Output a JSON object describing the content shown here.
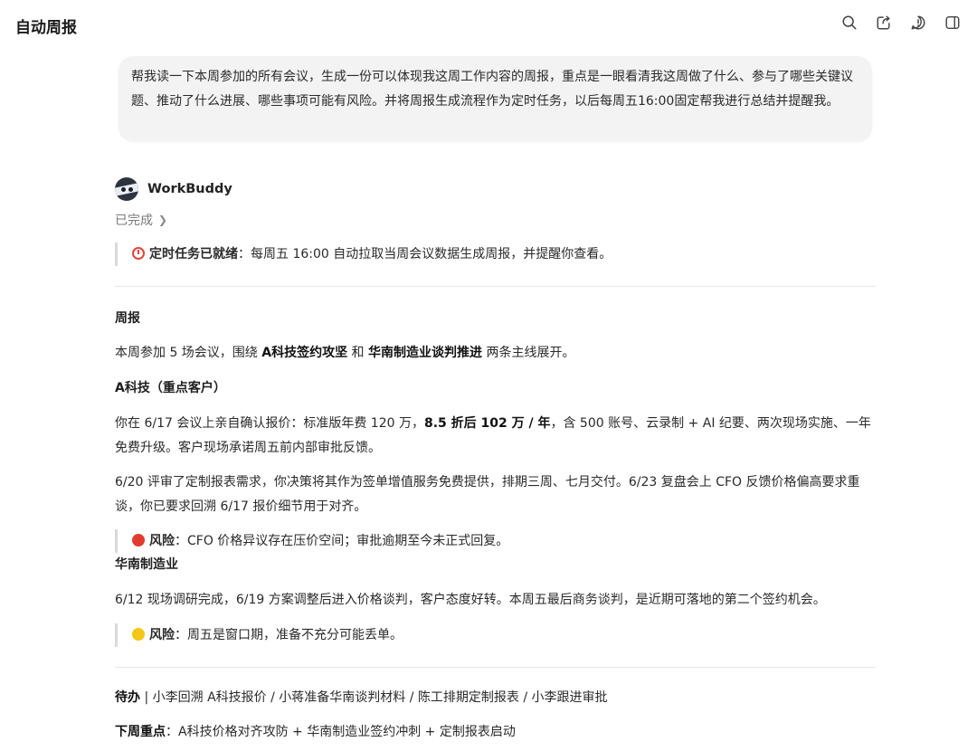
{
  "app": {
    "title": "自动周报"
  },
  "toolbar": {
    "search_icon": "search-icon",
    "share_icon": "share-icon",
    "info_icon": "alert-icon",
    "panel_icon": "sidebar-toggle-icon"
  },
  "user_message": "帮我读一下本周参加的所有会议，生成一份可以体现我这周工作内容的周报，重点是一眼看清我这周做了什么、参与了哪些关键议题、推动了什么进展、哪些事项可能有风险。并将周报生成流程作为定时任务，以后每周五16:00固定帮我进行总结并提醒我。",
  "assistant": {
    "name": "WorkBuddy",
    "status": "已完成",
    "task_ready_label": "定时任务已就绪",
    "task_ready_text": "：每周五 16:00 自动拉取当周会议数据生成周报，并提醒你查看。"
  },
  "report": {
    "title": "周报",
    "intro_pre": "本周参加 5 场会议，围绕 ",
    "intro_b1": "A科技签约攻坚",
    "intro_mid": " 和 ",
    "intro_b2": "华南制造业谈判推进",
    "intro_post": " 两条主线展开。",
    "section_a_title": "A科技（重点客户）",
    "a_p1_pre": "你在 6/17 会议上亲自确认报价：标准版年费 120 万，",
    "a_p1_bold": "8.5 折后 102 万 / 年",
    "a_p1_post": "，含 500 账号、云录制 + AI 纪要、两次现场实施、一年免费升级。客户现场承诺周五前内部审批反馈。",
    "a_p2": "6/20 评审了定制报表需求，你决策将其作为签单增值服务免费提供，排期三周、七月交付。6/23 复盘会上 CFO 反馈价格偏高要求重谈，你已要求回溯 6/17 报价细节用于对齐。",
    "risk_label": "风险",
    "a_risk_text": "：CFO 价格异议存在压价空间；审批逾期至今未正式回复。",
    "section_b_title": "华南制造业",
    "b_p1": "6/12 现场调研完成，6/19 方案调整后进入价格谈判，客户态度好转。本周五最后商务谈判，是近期可落地的第二个签约机会。",
    "b_risk_text": "：周五是窗口期，准备不充分可能丢单。",
    "todo_label": "待办",
    "todo_text": " | 小李回溯 A科技报价 / 小蒋准备华南谈判材料 / 陈工排期定制报表 / 小李跟进审批",
    "next_label": "下周重点",
    "next_text": "：A科技价格对齐攻防 + 华南制造业签约冲刺 + 定制报表启动"
  },
  "colors": {
    "risk_red": "#e23b2e",
    "risk_yellow": "#f5c518",
    "clock_red": "#e0453a"
  }
}
